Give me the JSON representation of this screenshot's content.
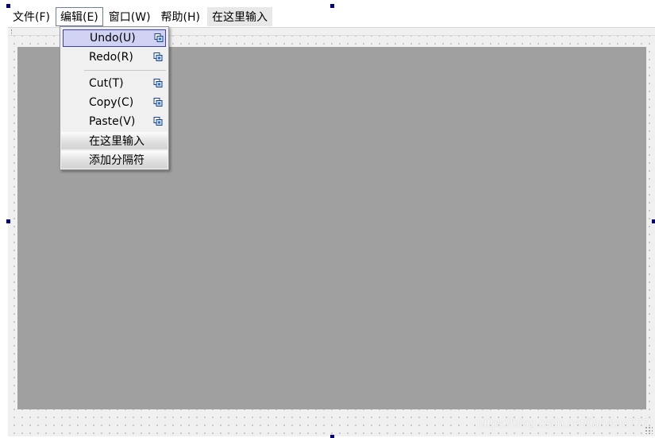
{
  "menubar": {
    "items": [
      {
        "label": "文件(F)"
      },
      {
        "label": "编辑(E)"
      },
      {
        "label": "窗口(W)"
      },
      {
        "label": "帮助(H)"
      },
      {
        "label": "在这里输入"
      }
    ]
  },
  "edit_menu": {
    "items": [
      {
        "label": "Undo(U)",
        "icon": "action-icon"
      },
      {
        "label": "Redo(R)",
        "icon": "action-icon"
      },
      {
        "label": "Cut(T)",
        "icon": "action-icon"
      },
      {
        "label": "Copy(C)",
        "icon": "action-icon"
      },
      {
        "label": "Paste(V)",
        "icon": "action-icon"
      }
    ],
    "type_here": "在这里输入",
    "add_separator": "添加分隔符"
  },
  "watermark": "https://blog.csdn.net/jiaruitao777",
  "colors": {
    "selection_fill": "#d0d2f4",
    "selection_border": "#3b40b8",
    "client_area": "#a0a0a0",
    "handle": "#000080"
  }
}
